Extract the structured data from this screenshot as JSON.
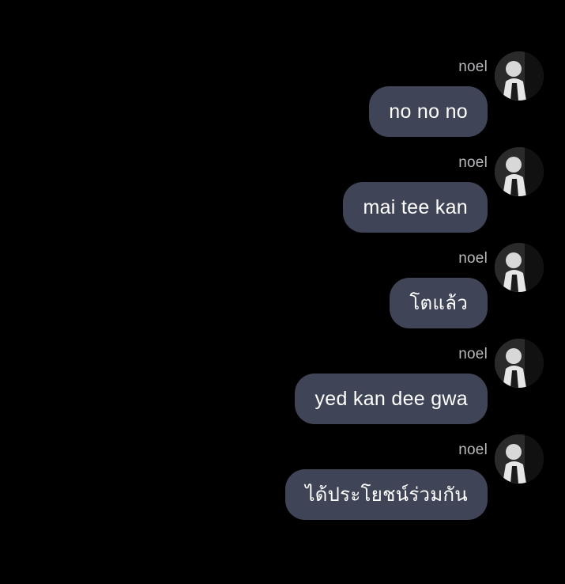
{
  "messages": [
    {
      "sender": "noel",
      "text": "no no no"
    },
    {
      "sender": "noel",
      "text": "mai tee kan"
    },
    {
      "sender": "noel",
      "text": "โตแล้ว"
    },
    {
      "sender": "noel",
      "text": "yed kan dee gwa"
    },
    {
      "sender": "noel",
      "text": "ได้ประโยชน์ร่วมกัน"
    }
  ],
  "colors": {
    "background": "#000000",
    "bubble": "#3f4557",
    "bubble_text": "#ffffff",
    "sender_name": "#b9b9bd"
  },
  "icons": {
    "avatar": "profile-photo"
  }
}
